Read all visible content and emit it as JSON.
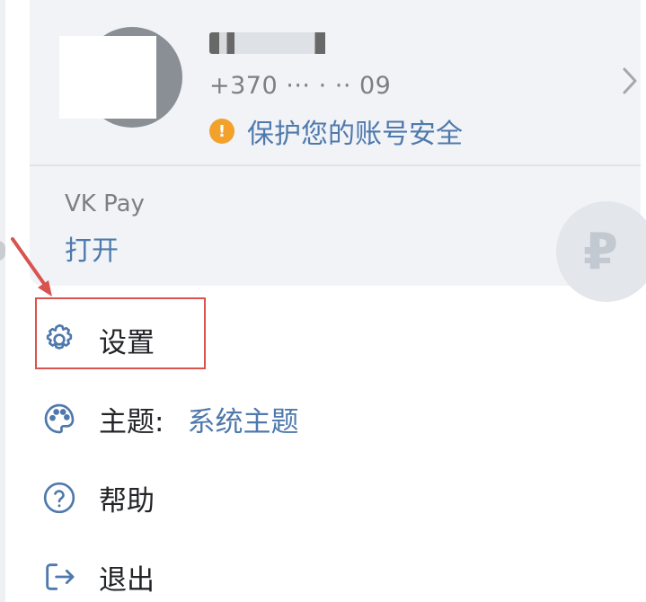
{
  "profile": {
    "phone": "+370 ··· · ·· 09",
    "security_prompt": "保护您的账号安全"
  },
  "vkpay": {
    "label": "VK Pay",
    "action": "打开",
    "currency_symbol": "₽"
  },
  "menu": {
    "settings": {
      "label": "设置",
      "icon": "gear-icon"
    },
    "theme": {
      "label": "主题:",
      "value": "系统主题",
      "icon": "palette-icon"
    },
    "help": {
      "label": "帮助",
      "icon": "question-circle-icon"
    },
    "logout": {
      "label": "退出",
      "icon": "logout-icon"
    }
  },
  "colors": {
    "accent": "#4f79ad",
    "warning": "#f2a12b",
    "annotation": "#d9534f",
    "card_bg": "#f1f3f6"
  }
}
